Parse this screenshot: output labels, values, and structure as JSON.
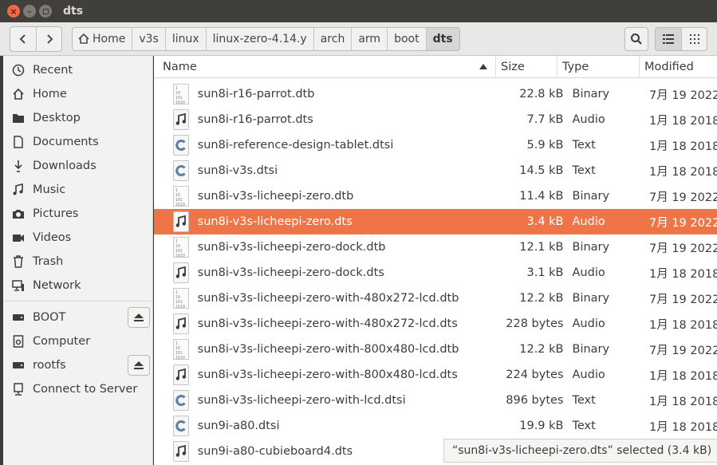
{
  "window": {
    "title": "dts"
  },
  "breadcrumbs": [
    "Home",
    "v3s",
    "linux",
    "linux-zero-4.14.y",
    "arch",
    "arm",
    "boot",
    "dts"
  ],
  "sidebar": {
    "places": [
      {
        "label": "Recent",
        "icon": "clock-icon"
      },
      {
        "label": "Home",
        "icon": "home-icon"
      },
      {
        "label": "Desktop",
        "icon": "folder-icon"
      },
      {
        "label": "Documents",
        "icon": "document-icon"
      },
      {
        "label": "Downloads",
        "icon": "download-icon"
      },
      {
        "label": "Music",
        "icon": "music-icon"
      },
      {
        "label": "Pictures",
        "icon": "camera-icon"
      },
      {
        "label": "Videos",
        "icon": "video-icon"
      },
      {
        "label": "Trash",
        "icon": "trash-icon"
      },
      {
        "label": "Network",
        "icon": "network-icon"
      }
    ],
    "devices": [
      {
        "label": "BOOT",
        "icon": "drive-icon",
        "eject": true
      },
      {
        "label": "Computer",
        "icon": "computer-icon",
        "eject": false
      },
      {
        "label": "rootfs",
        "icon": "drive-icon",
        "eject": true
      },
      {
        "label": "Connect to Server",
        "icon": "server-icon",
        "eject": false
      }
    ]
  },
  "columns": {
    "name": "Name",
    "size": "Size",
    "type": "Type",
    "modified": "Modified"
  },
  "files": [
    {
      "name": "sun8i-r16-parrot.dtb",
      "size": "22.8 kB",
      "type": "Binary",
      "modified": "7月 19 2022",
      "kind": "binary"
    },
    {
      "name": "sun8i-r16-parrot.dts",
      "size": "7.7 kB",
      "type": "Audio",
      "modified": "1月 18 2018",
      "kind": "audio"
    },
    {
      "name": "sun8i-reference-design-tablet.dtsi",
      "size": "5.9 kB",
      "type": "Text",
      "modified": "1月 18 2018",
      "kind": "text"
    },
    {
      "name": "sun8i-v3s.dtsi",
      "size": "14.5 kB",
      "type": "Text",
      "modified": "1月 18 2018",
      "kind": "text"
    },
    {
      "name": "sun8i-v3s-licheepi-zero.dtb",
      "size": "11.4 kB",
      "type": "Binary",
      "modified": "7月 19 2022",
      "kind": "binary"
    },
    {
      "name": "sun8i-v3s-licheepi-zero.dts",
      "size": "3.4 kB",
      "type": "Audio",
      "modified": "7月 19 2022",
      "kind": "audio",
      "selected": true
    },
    {
      "name": "sun8i-v3s-licheepi-zero-dock.dtb",
      "size": "12.1 kB",
      "type": "Binary",
      "modified": "7月 19 2022",
      "kind": "binary"
    },
    {
      "name": "sun8i-v3s-licheepi-zero-dock.dts",
      "size": "3.1 kB",
      "type": "Audio",
      "modified": "1月 18 2018",
      "kind": "audio"
    },
    {
      "name": "sun8i-v3s-licheepi-zero-with-480x272-lcd.dtb",
      "size": "12.2 kB",
      "type": "Binary",
      "modified": "7月 19 2022",
      "kind": "binary"
    },
    {
      "name": "sun8i-v3s-licheepi-zero-with-480x272-lcd.dts",
      "size": "228 bytes",
      "type": "Audio",
      "modified": "1月 18 2018",
      "kind": "audio"
    },
    {
      "name": "sun8i-v3s-licheepi-zero-with-800x480-lcd.dtb",
      "size": "12.2 kB",
      "type": "Binary",
      "modified": "7月 19 2022",
      "kind": "binary"
    },
    {
      "name": "sun8i-v3s-licheepi-zero-with-800x480-lcd.dts",
      "size": "224 bytes",
      "type": "Audio",
      "modified": "1月 18 2018",
      "kind": "audio"
    },
    {
      "name": "sun8i-v3s-licheepi-zero-with-lcd.dtsi",
      "size": "896 bytes",
      "type": "Text",
      "modified": "1月 18 2018",
      "kind": "text"
    },
    {
      "name": "sun9i-a80.dtsi",
      "size": "19.9 kB",
      "type": "Text",
      "modified": "1月 18 2018",
      "kind": "text"
    },
    {
      "name": "sun9i-a80-cubieboard4.dts",
      "size": "",
      "type": "",
      "modified": "",
      "kind": "audio"
    }
  ],
  "status": {
    "text": "“sun8i-v3s-licheepi-zero.dts” selected  (3.4 kB)"
  },
  "colors": {
    "selection": "#ef7447",
    "titlebar": "#403f3b",
    "close": "#ef6a43"
  }
}
